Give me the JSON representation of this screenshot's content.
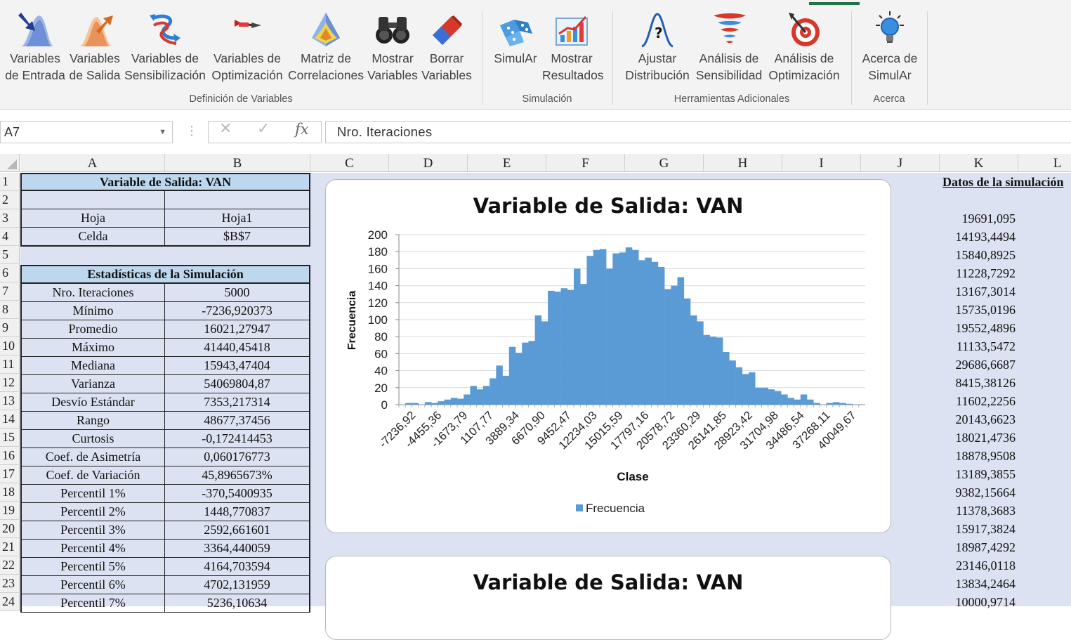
{
  "ribbon": {
    "buttons": [
      {
        "id": "variables-entrada",
        "label": "Variables\nde Entrada",
        "icon": "input-variables-icon"
      },
      {
        "id": "variables-salida",
        "label": "Variables\nde Salida",
        "icon": "output-variables-icon"
      },
      {
        "id": "variables-sensibilizacion",
        "label": "Variables de\nSensibilización",
        "icon": "sensitivity-arrows-icon"
      },
      {
        "id": "variables-optimizacion",
        "label": "Variables de\nOptimización",
        "icon": "dart-icon"
      },
      {
        "id": "matriz-correlaciones",
        "label": "Matriz de\nCorrelaciones",
        "icon": "correlation-matrix-icon"
      },
      {
        "id": "mostrar-variables",
        "label": "Mostrar\nVariables",
        "icon": "binoculars-icon"
      },
      {
        "id": "borrar-variables",
        "label": "Borrar\nVariables",
        "icon": "eraser-icon"
      },
      {
        "id": "simular",
        "label": "SimulAr",
        "icon": "dice-icon"
      },
      {
        "id": "mostrar-resultados",
        "label": "Mostrar\nResultados",
        "icon": "results-chart-icon"
      },
      {
        "id": "ajustar-distribucion",
        "label": "Ajustar\nDistribución",
        "icon": "fit-distribution-icon"
      },
      {
        "id": "analisis-sensibilidad",
        "label": "Análisis de\nSensibilidad",
        "icon": "tornado-icon"
      },
      {
        "id": "analisis-optimizacion",
        "label": "Análisis de\nOptimización",
        "icon": "target-icon"
      },
      {
        "id": "acerca-simular",
        "label": "Acerca de\nSimulAr",
        "icon": "lightbulb-icon"
      }
    ],
    "groups": [
      "Definición de Variables",
      "Simulación",
      "Herramientas Adicionales",
      "Acerca"
    ]
  },
  "formula_bar": {
    "name_box": "A7",
    "formula": "Nro. Iteraciones",
    "cancel_symbol": "✕",
    "enter_symbol": "✓",
    "fx_symbol": "fx"
  },
  "columns": [
    "A",
    "B",
    "C",
    "D",
    "E",
    "F",
    "G",
    "H",
    "I",
    "J",
    "K",
    "L"
  ],
  "rows": [
    "1",
    "2",
    "3",
    "4",
    "5",
    "6",
    "7",
    "8",
    "9",
    "10",
    "11",
    "12",
    "13",
    "14",
    "15",
    "16",
    "17",
    "18",
    "19",
    "20",
    "21",
    "22",
    "23",
    "24"
  ],
  "sheet": {
    "output_header": "Variable de Salida: VAN",
    "hoja_label": "Hoja",
    "hoja_value": "Hoja1",
    "celda_label": "Celda",
    "celda_value": "$B$7",
    "stats_header": "Estadísticas de la Simulación",
    "stats": [
      {
        "label": "Nro. Iteraciones",
        "value": "5000"
      },
      {
        "label": "Mínimo",
        "value": "-7236,920373"
      },
      {
        "label": "Promedio",
        "value": "16021,27947"
      },
      {
        "label": "Máximo",
        "value": "41440,45418"
      },
      {
        "label": "Mediana",
        "value": "15943,47404"
      },
      {
        "label": "Varianza",
        "value": "54069804,87"
      },
      {
        "label": "Desvío Estándar",
        "value": "7353,217314"
      },
      {
        "label": "Rango",
        "value": "48677,37456"
      },
      {
        "label": "Curtosis",
        "value": "-0,172414453"
      },
      {
        "label": "Coef. de Asimetría",
        "value": "0,060176773"
      },
      {
        "label": "Coef. de Variación",
        "value": "45,8965673%"
      },
      {
        "label": "Percentil 1%",
        "value": "-370,5400935"
      },
      {
        "label": "Percentil 2%",
        "value": "1448,770837"
      },
      {
        "label": "Percentil 3%",
        "value": "2592,661601"
      },
      {
        "label": "Percentil 4%",
        "value": "3364,440059"
      },
      {
        "label": "Percentil 5%",
        "value": "4164,703594"
      },
      {
        "label": "Percentil 6%",
        "value": "4702,131959"
      },
      {
        "label": "Percentil 7%",
        "value": "5236,10634"
      }
    ],
    "data_title": "Datos de la simulación",
    "data_values": [
      "19691,095",
      "14193,4494",
      "15840,8925",
      "11228,7292",
      "13167,3014",
      "15735,0196",
      "19552,4896",
      "11133,5472",
      "29686,6687",
      "8415,38126",
      "11602,2256",
      "20143,6623",
      "18021,4736",
      "18878,9508",
      "13189,3855",
      "9382,15664",
      "11378,3683",
      "15917,3824",
      "18987,4292",
      "23146,0118",
      "13834,2464",
      "10000,9714"
    ]
  },
  "chart_data": {
    "type": "bar",
    "title": "Variable de Salida: VAN",
    "xlabel": "Clase",
    "ylabel": "Frecuencia",
    "ylim": [
      0,
      200
    ],
    "yticks": [
      0,
      20,
      40,
      60,
      80,
      100,
      120,
      140,
      160,
      180,
      200
    ],
    "grid": true,
    "legend": "bottom",
    "bar_color": "#5b9bd5",
    "tick_labels": [
      "-7236,92",
      "-4455,36",
      "-1673,79",
      "1107,77",
      "3889,34",
      "6670,90",
      "9452,47",
      "12234,03",
      "15015,59",
      "17797,16",
      "20578,72",
      "23360,29",
      "26141,85",
      "28923,42",
      "31704,98",
      "34486,54",
      "37268,11",
      "40049,67"
    ],
    "series": [
      {
        "name": "Frecuencia",
        "values": [
          0,
          2,
          2,
          0,
          3,
          2,
          4,
          6,
          8,
          7,
          12,
          22,
          18,
          22,
          31,
          46,
          34,
          68,
          61,
          73,
          75,
          105,
          98,
          134,
          133,
          137,
          135,
          160,
          142,
          175,
          182,
          183,
          160,
          178,
          179,
          185,
          182,
          170,
          173,
          168,
          162,
          136,
          140,
          150,
          125,
          105,
          98,
          82,
          80,
          79,
          62,
          52,
          44,
          36,
          38,
          20,
          20,
          18,
          16,
          12,
          8,
          6,
          12,
          6,
          2,
          0,
          2,
          3,
          2,
          1,
          0,
          0
        ]
      }
    ]
  },
  "chart2": {
    "title": "Variable de Salida: VAN"
  }
}
